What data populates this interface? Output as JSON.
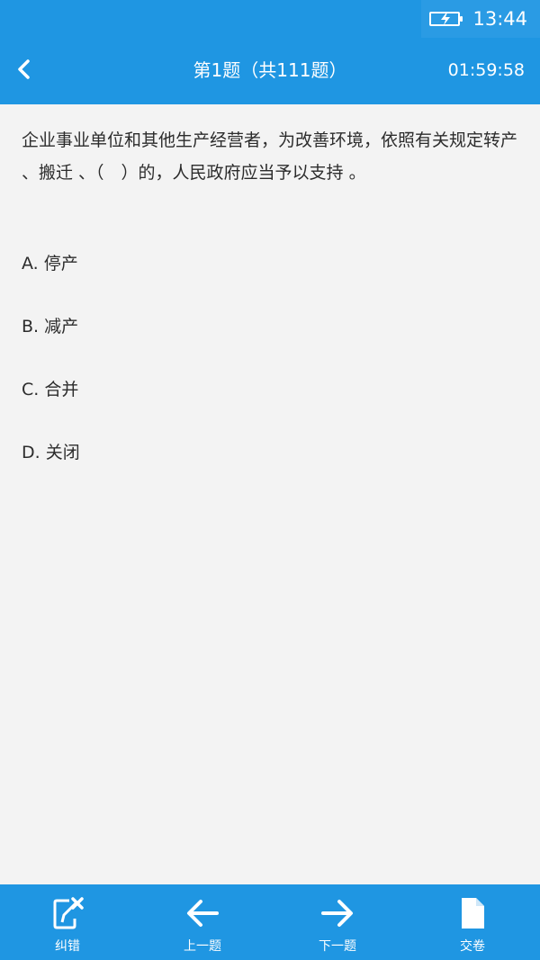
{
  "status_bar": {
    "time": "13:44",
    "battery_icon": "battery-charging-icon"
  },
  "header": {
    "back_icon": "chevron-left-icon",
    "title": "第1题（共111题）",
    "timer": "01:59:58"
  },
  "question": {
    "text": "企业事业单位和其他生产经营者，为改善环境，依照有关规定转产 、搬迁 、（　）的，人民政府应当予以支持 。",
    "options": [
      {
        "label": "A. 停产"
      },
      {
        "label": "B. 减产"
      },
      {
        "label": "C. 合并"
      },
      {
        "label": "D. 关闭"
      }
    ]
  },
  "bottom_nav": [
    {
      "label": "纠错",
      "icon": "edit-x-icon"
    },
    {
      "label": "上一题",
      "icon": "arrow-left-icon"
    },
    {
      "label": "下一题",
      "icon": "arrow-right-icon"
    },
    {
      "label": "交卷",
      "icon": "document-icon"
    }
  ],
  "colors": {
    "primary": "#1f96e2",
    "background": "#f3f3f3",
    "text": "#2c2c2c"
  }
}
